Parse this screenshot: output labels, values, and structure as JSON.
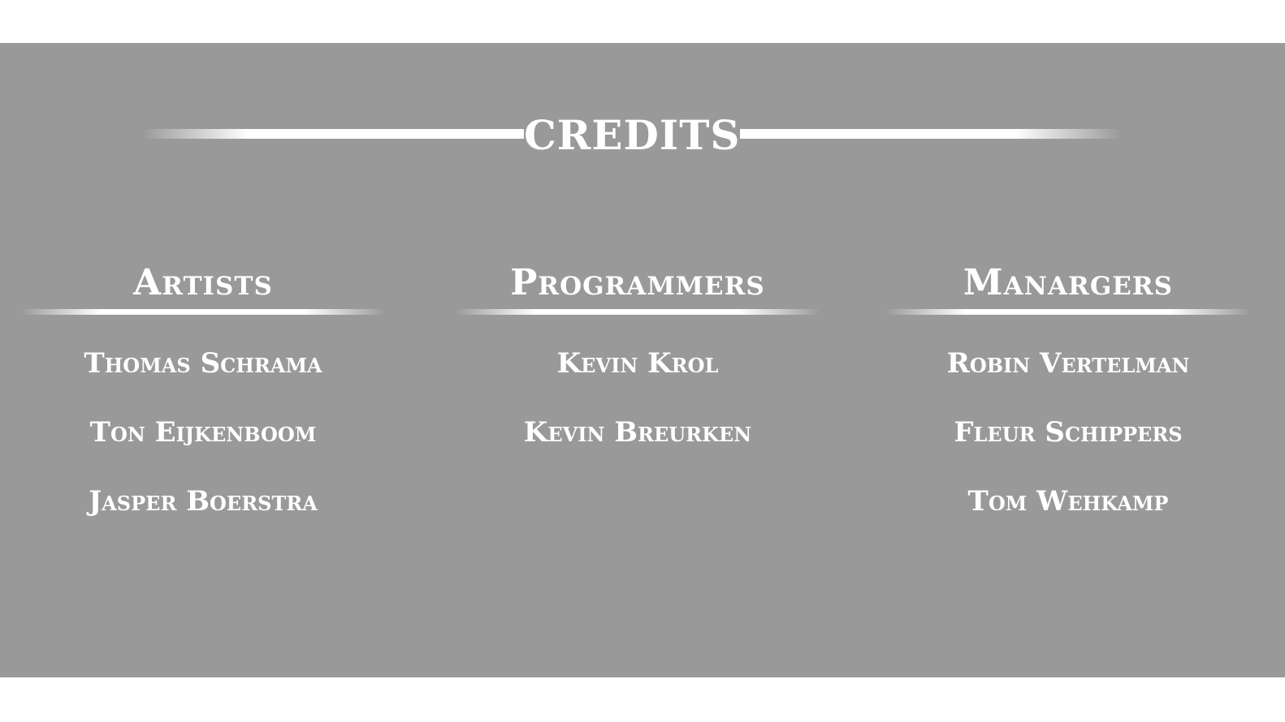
{
  "header": {
    "title": "CREDITS"
  },
  "columns": [
    {
      "title": "Artists",
      "names": [
        "Thomas Schrama",
        "Ton Eijkenboom",
        "Jasper Boerstra"
      ]
    },
    {
      "title": "Programmers",
      "names": [
        "Kevin Krol",
        "Kevin Breurken"
      ]
    },
    {
      "title": "Manargers",
      "names": [
        "Robin Vertelman",
        "Fleur Schippers",
        "Tom Wehkamp"
      ]
    }
  ],
  "colors": {
    "panel_background": "#999999",
    "page_background": "#ffffff",
    "text": "#ffffff"
  }
}
